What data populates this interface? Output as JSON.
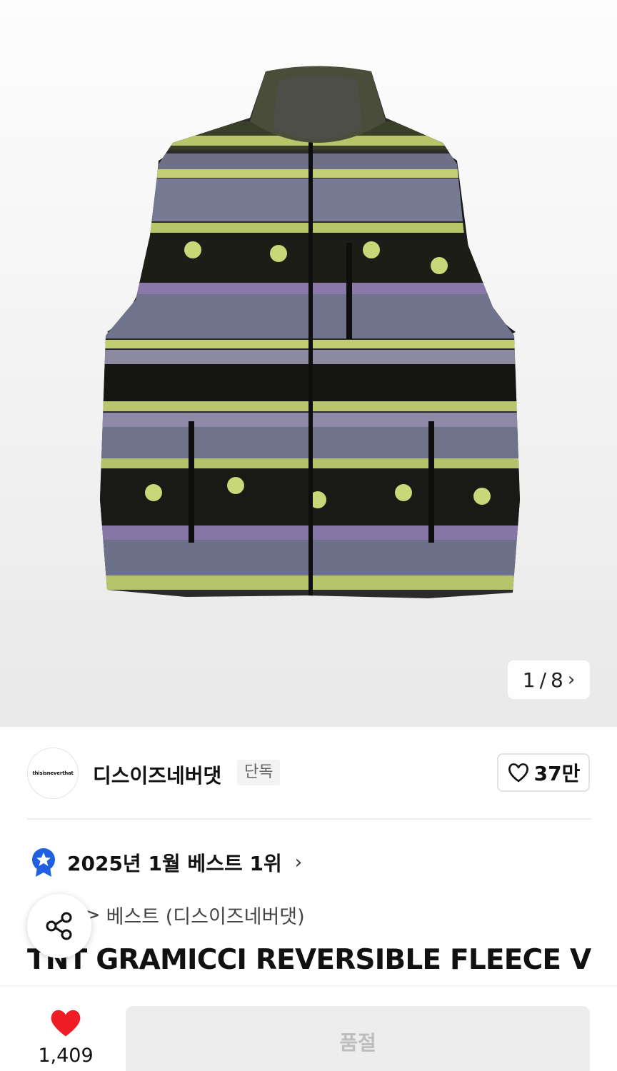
{
  "gallery": {
    "current_page": "1",
    "separator": "/",
    "total_pages": "8",
    "next_icon": "chevron-right-icon"
  },
  "brand": {
    "logo_text": "thisisneverthat",
    "name": "디스이즈네버댓",
    "badge": "단독",
    "like_count": "37만"
  },
  "ranking": {
    "text": "2025년 1월 베스트 1위",
    "icon": "ranking-medal-icon"
  },
  "breadcrumb": {
    "hidden_first": "",
    "separator": ">",
    "current": "베스트 (디스이즈네버댓)"
  },
  "product": {
    "title": "TNT GRAMICCI REVERSIBLE FLEECE VES"
  },
  "bottom_bar": {
    "like_count": "1,409",
    "buy_button_label": "품절"
  },
  "colors": {
    "heart": "#ee1c25",
    "medal_blue": "#1f5fe0",
    "soldout_bg": "#ededed"
  }
}
